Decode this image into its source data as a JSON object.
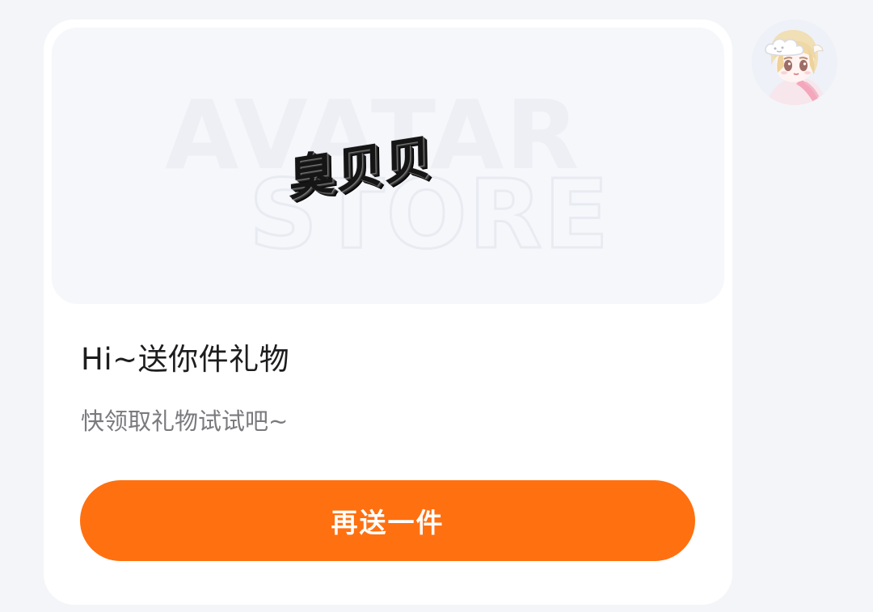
{
  "gift_preview": {
    "watermark_line1": "AVATAR",
    "watermark_line2": "STORE",
    "gift_name": "臭贝贝"
  },
  "message": {
    "title": "Hi~送你件礼物",
    "subtitle": "快领取礼物试试吧~"
  },
  "actions": {
    "send_again_label": "再送一件"
  },
  "colors": {
    "page_background": "#f4f5f8",
    "card_background": "#ffffff",
    "preview_background": "#f6f7fb",
    "button_orange": "#ff7010",
    "title_text": "#1d1d1f",
    "subtitle_text": "#7a7a7e"
  },
  "icons": {
    "avatar": "anime-avatar-image"
  }
}
